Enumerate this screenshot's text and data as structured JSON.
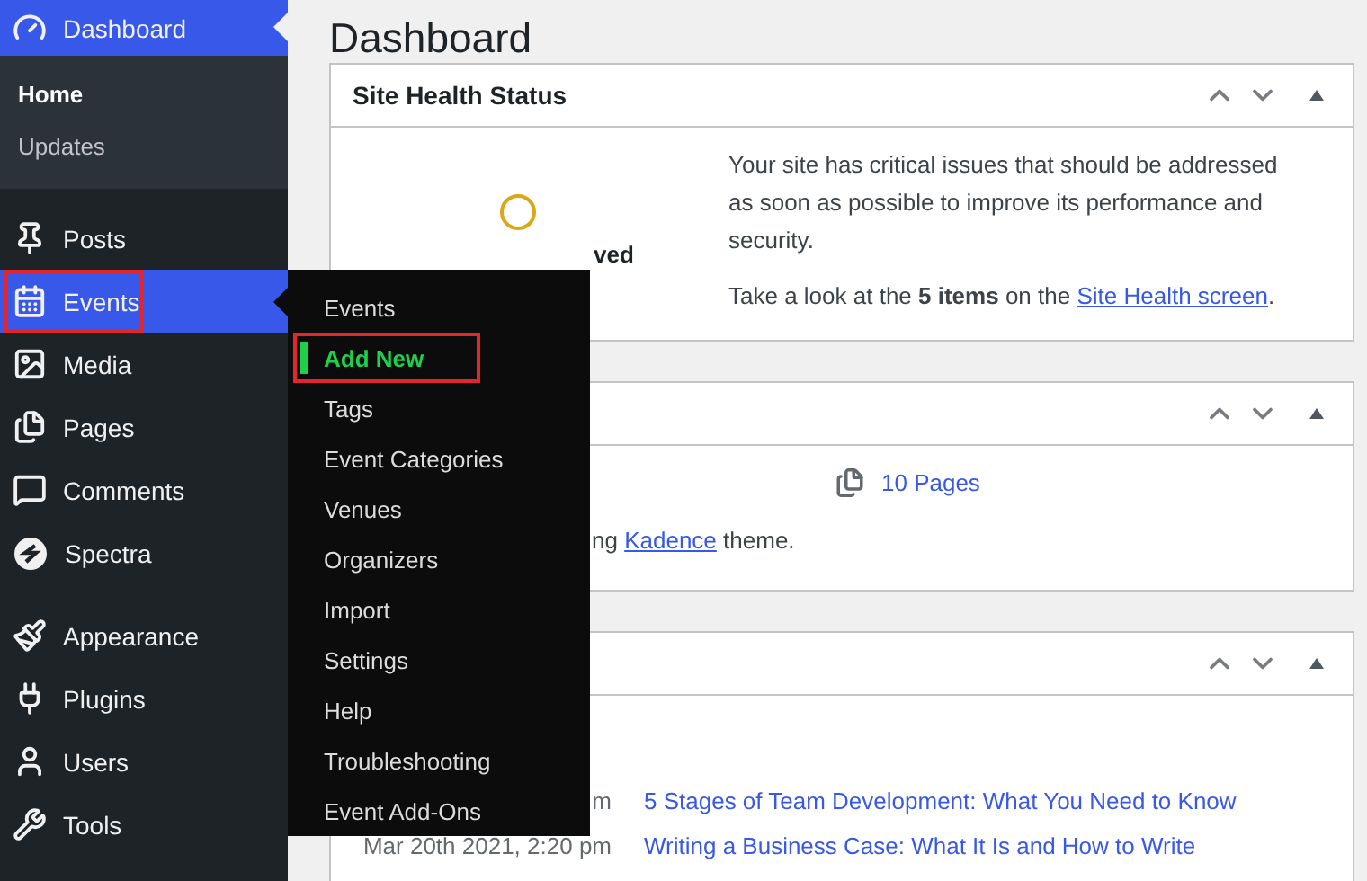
{
  "sidebar": {
    "groups": [
      [
        {
          "label": "Dashboard",
          "selected": true,
          "highlighted": false,
          "children": [
            {
              "label": "Home",
              "selected": true
            },
            {
              "label": "Updates",
              "selected": false
            }
          ]
        }
      ],
      [
        {
          "label": "Posts",
          "selected": false,
          "highlighted": false
        },
        {
          "label": "Events",
          "selected": true,
          "highlighted": true
        },
        {
          "label": "Media",
          "selected": false,
          "highlighted": false
        },
        {
          "label": "Pages",
          "selected": false,
          "highlighted": false
        },
        {
          "label": "Comments",
          "selected": false,
          "highlighted": false
        },
        {
          "label": "Spectra",
          "selected": false,
          "highlighted": false
        }
      ],
      [
        {
          "label": "Appearance",
          "selected": false,
          "highlighted": false
        },
        {
          "label": "Plugins",
          "selected": false,
          "highlighted": false
        },
        {
          "label": "Users",
          "selected": false,
          "highlighted": false
        },
        {
          "label": "Tools",
          "selected": false,
          "highlighted": false
        }
      ]
    ]
  },
  "flyout": {
    "items": [
      {
        "label": "Events",
        "selected": false,
        "highlighted": false
      },
      {
        "label": "Add New",
        "selected": true,
        "highlighted": true
      },
      {
        "label": "Tags",
        "selected": false,
        "highlighted": false
      },
      {
        "label": "Event Categories",
        "selected": false,
        "highlighted": false
      },
      {
        "label": "Venues",
        "selected": false,
        "highlighted": false
      },
      {
        "label": "Organizers",
        "selected": false,
        "highlighted": false
      },
      {
        "label": "Import",
        "selected": false,
        "highlighted": false
      },
      {
        "label": "Settings",
        "selected": false,
        "highlighted": false
      },
      {
        "label": "Help",
        "selected": false,
        "highlighted": false
      },
      {
        "label": "Troubleshooting",
        "selected": false,
        "highlighted": false
      },
      {
        "label": "Event Add-Ons",
        "selected": false,
        "highlighted": false
      }
    ]
  },
  "page_title": "Dashboard",
  "site_health": {
    "title": "Site Health Status",
    "status": "ved",
    "message": "Your site has critical issues that should be addressed as soon as possible to improve its performance and security.",
    "prompt": "Take a look at the **5 items** on the",
    "link": "Site Health screen",
    "prompt_end": "."
  },
  "glance": {
    "pages": "10 Pages",
    "theme_before": "ng",
    "theme_link": "Kadence",
    "theme_after": "theme."
  },
  "activity": {
    "rows": [
      {
        "date": "m",
        "title": "5 Stages of Team Development: What You Need to Know"
      },
      {
        "date": "Mar 20th 2021, 2:20 pm",
        "title": "Writing a Business Case: What It Is and How to Write"
      }
    ]
  }
}
